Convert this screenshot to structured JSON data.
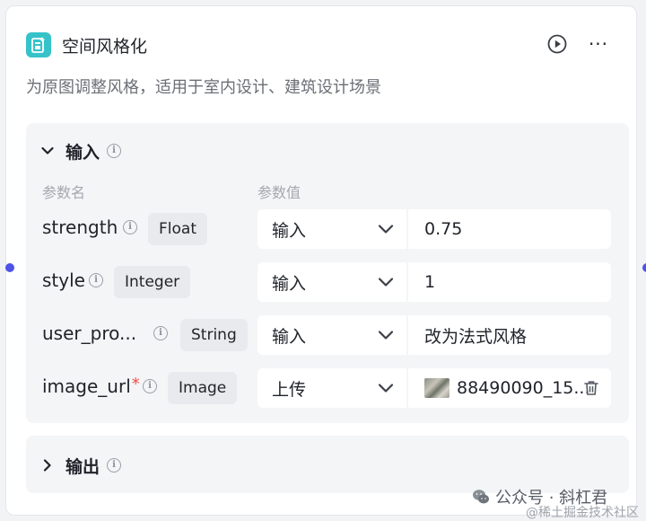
{
  "node": {
    "title": "空间风格化",
    "description": "为原图调整风格，适用于室内设计、建筑设计场景",
    "more_label": "···",
    "accent": "#35c3c9",
    "port_color": "#4d53e8"
  },
  "input_section": {
    "label": "输入",
    "col_param_name": "参数名",
    "col_param_value": "参数值",
    "params": [
      {
        "name": "strength",
        "required": "",
        "type": "Float",
        "mode": "输入",
        "value": "0.75"
      },
      {
        "name": "style",
        "required": "",
        "type": "Integer",
        "mode": "输入",
        "value": "1"
      },
      {
        "name": "user_pro...",
        "required": "",
        "type": "String",
        "mode": "输入",
        "value": "改为法式风格"
      },
      {
        "name": "image_url",
        "required": "*",
        "type": "Image",
        "mode": "上传",
        "value": "88490090_15..."
      }
    ]
  },
  "output_section": {
    "label": "输出"
  },
  "watermark": {
    "text": "公众号 · 斜杠君",
    "subtext": "@稀土掘金技术社区"
  },
  "icons": {
    "app": "image-style-icon",
    "run": "play-icon",
    "expand": "chevron-down-icon",
    "collapse": "chevron-right-icon",
    "info": "info-icon",
    "delete": "trash-icon"
  }
}
